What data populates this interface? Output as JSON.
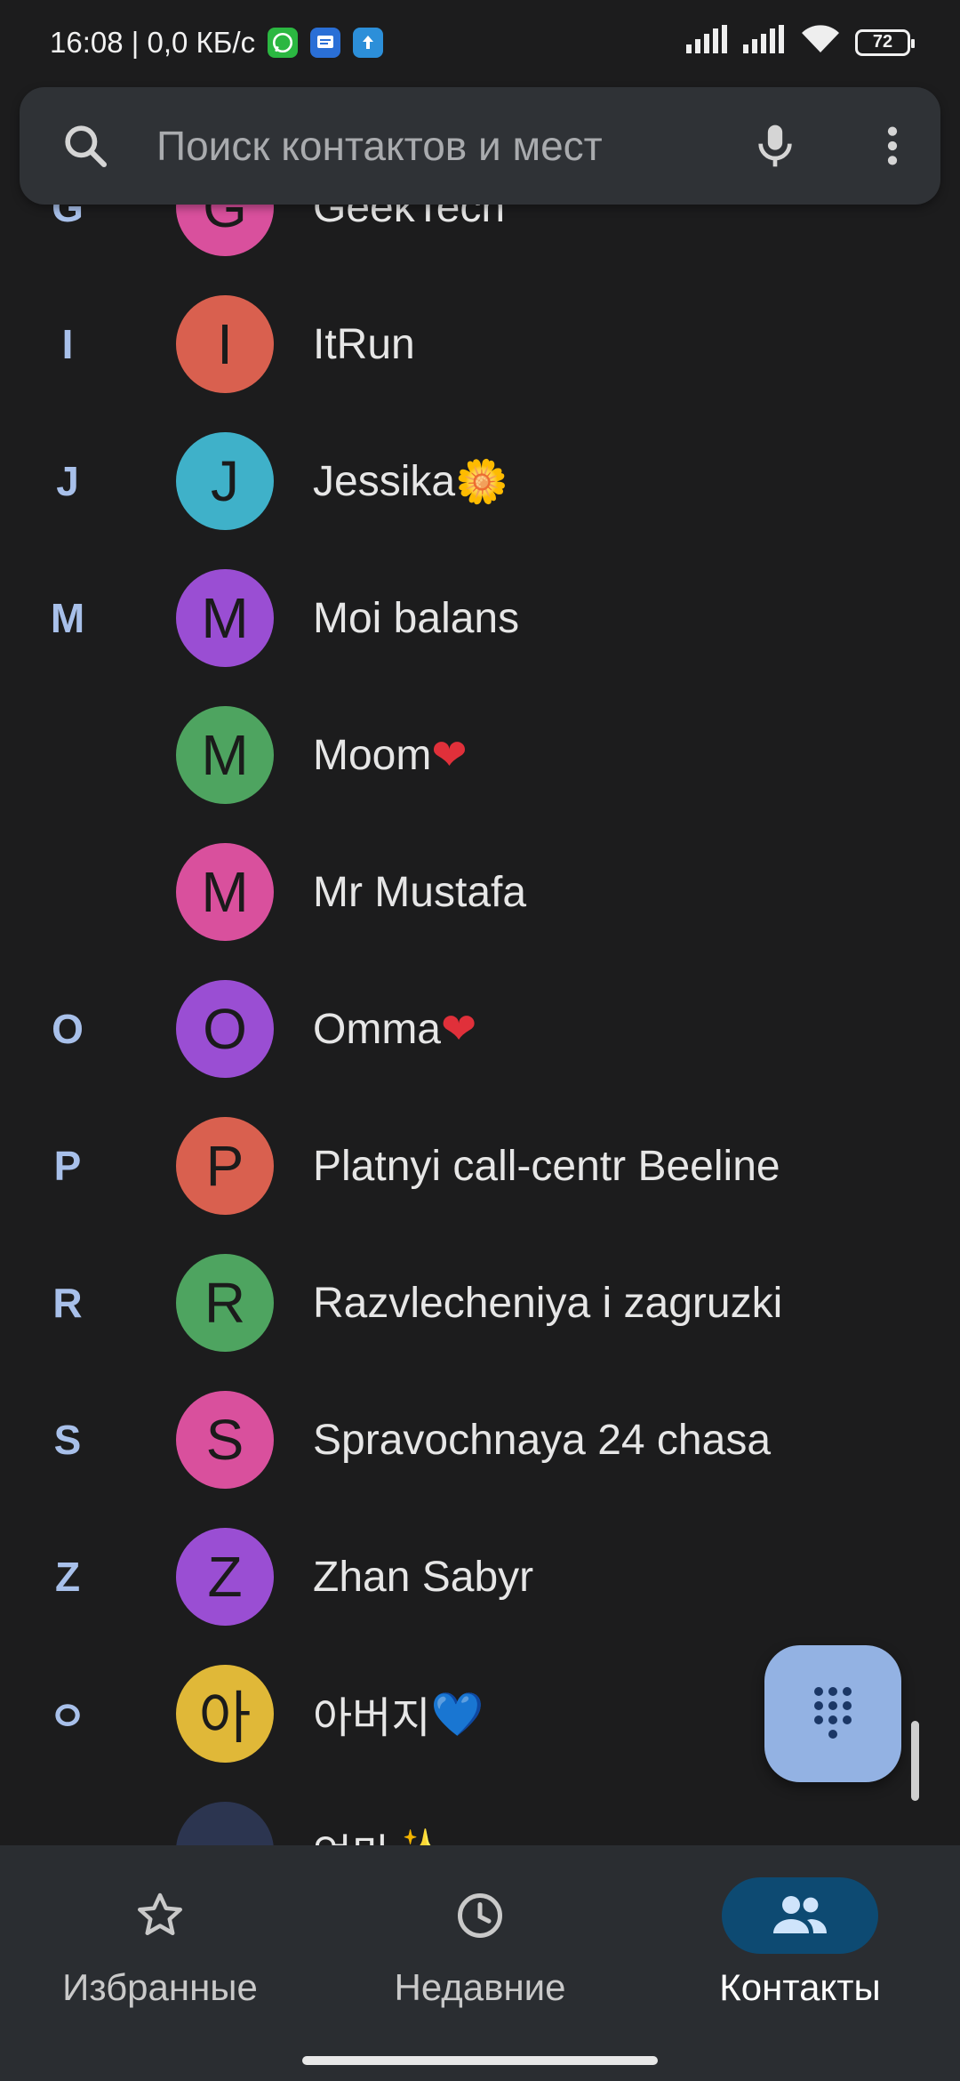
{
  "status_bar": {
    "time_and_speed": "16:08 | 0,0 КБ/с",
    "battery": "72",
    "app_icons": [
      "whatsapp-icon",
      "messages-icon",
      "upload-icon"
    ]
  },
  "search": {
    "placeholder": "Поиск контактов и мест"
  },
  "contacts": [
    {
      "letter": "G",
      "initial": "G",
      "name": "GeekTech",
      "avatar_color": "#d9509d"
    },
    {
      "letter": "I",
      "initial": "I",
      "name": "ItRun",
      "avatar_color": "#d9604f"
    },
    {
      "letter": "J",
      "initial": "J",
      "name": "Jessika",
      "emoji": "🌼",
      "avatar_color": "#3fb1c9"
    },
    {
      "letter": "M",
      "initial": "M",
      "name": "Moi balans",
      "avatar_color": "#9a4ed3"
    },
    {
      "letter": "",
      "initial": "M",
      "name": "Moom",
      "emoji": "❤",
      "avatar_color": "#4ea460"
    },
    {
      "letter": "",
      "initial": "M",
      "name": "Mr Mustafa",
      "avatar_color": "#d9509d"
    },
    {
      "letter": "O",
      "initial": "O",
      "name": "Omma",
      "emoji": "❤",
      "avatar_color": "#9a4ed3"
    },
    {
      "letter": "P",
      "initial": "P",
      "name": "Platnyi call-centr Beeline",
      "avatar_color": "#d9604f"
    },
    {
      "letter": "R",
      "initial": "R",
      "name": "Razvlecheniya i zagruzki",
      "avatar_color": "#4ea460"
    },
    {
      "letter": "S",
      "initial": "S",
      "name": "Spravochnaya 24 chasa",
      "avatar_color": "#d9509d"
    },
    {
      "letter": "Z",
      "initial": "Z",
      "name": "Zhan Sabyr",
      "avatar_color": "#9a4ed3"
    },
    {
      "letter": "ㅇ",
      "initial": "아",
      "name": "아버지",
      "emoji": "💙",
      "avatar_color": "#e0b838"
    },
    {
      "letter": "",
      "initial": "",
      "name": "엄마",
      "emoji": "✨",
      "avatar_color": "#2c3550"
    }
  ],
  "fab": {
    "icon": "dialpad-icon"
  },
  "bottom_nav": [
    {
      "label": "Избранные",
      "icon": "star-icon",
      "active": false
    },
    {
      "label": "Недавние",
      "icon": "clock-icon",
      "active": false
    },
    {
      "label": "Контакты",
      "icon": "people-icon",
      "active": true
    }
  ],
  "colors": {
    "background": "#1c1c1d",
    "accent": "#93b2e3",
    "section_letter": "#a8c0ea",
    "active_pill": "#0d4a72"
  }
}
